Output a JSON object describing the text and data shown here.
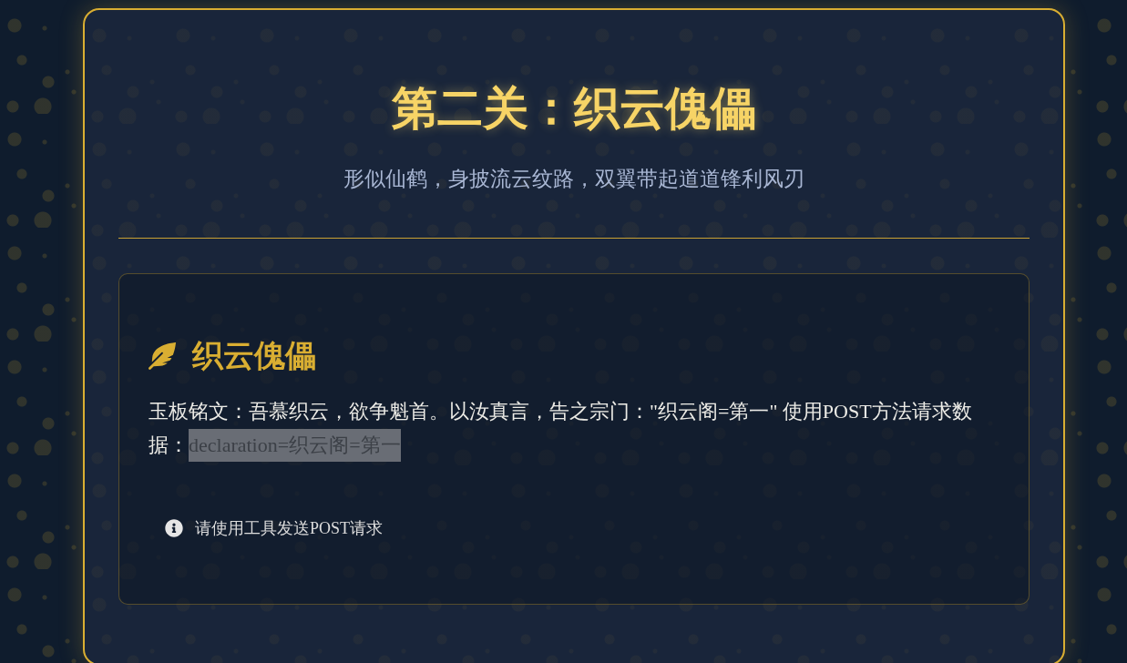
{
  "level": {
    "title": "第二关：织云傀儡",
    "subtitle": "形似仙鹤，身披流云纹路，双翼带起道道锋利风刃"
  },
  "card": {
    "heading": "织云傀儡",
    "instruction": "玉板铭文：吾慕织云，欲争魁首。以汝真言，告之宗门：\"织云阁=第一\" 使用POST方法请求数据：",
    "code": "declaration=织云阁=第一",
    "hint": "请使用工具发送POST请求"
  }
}
